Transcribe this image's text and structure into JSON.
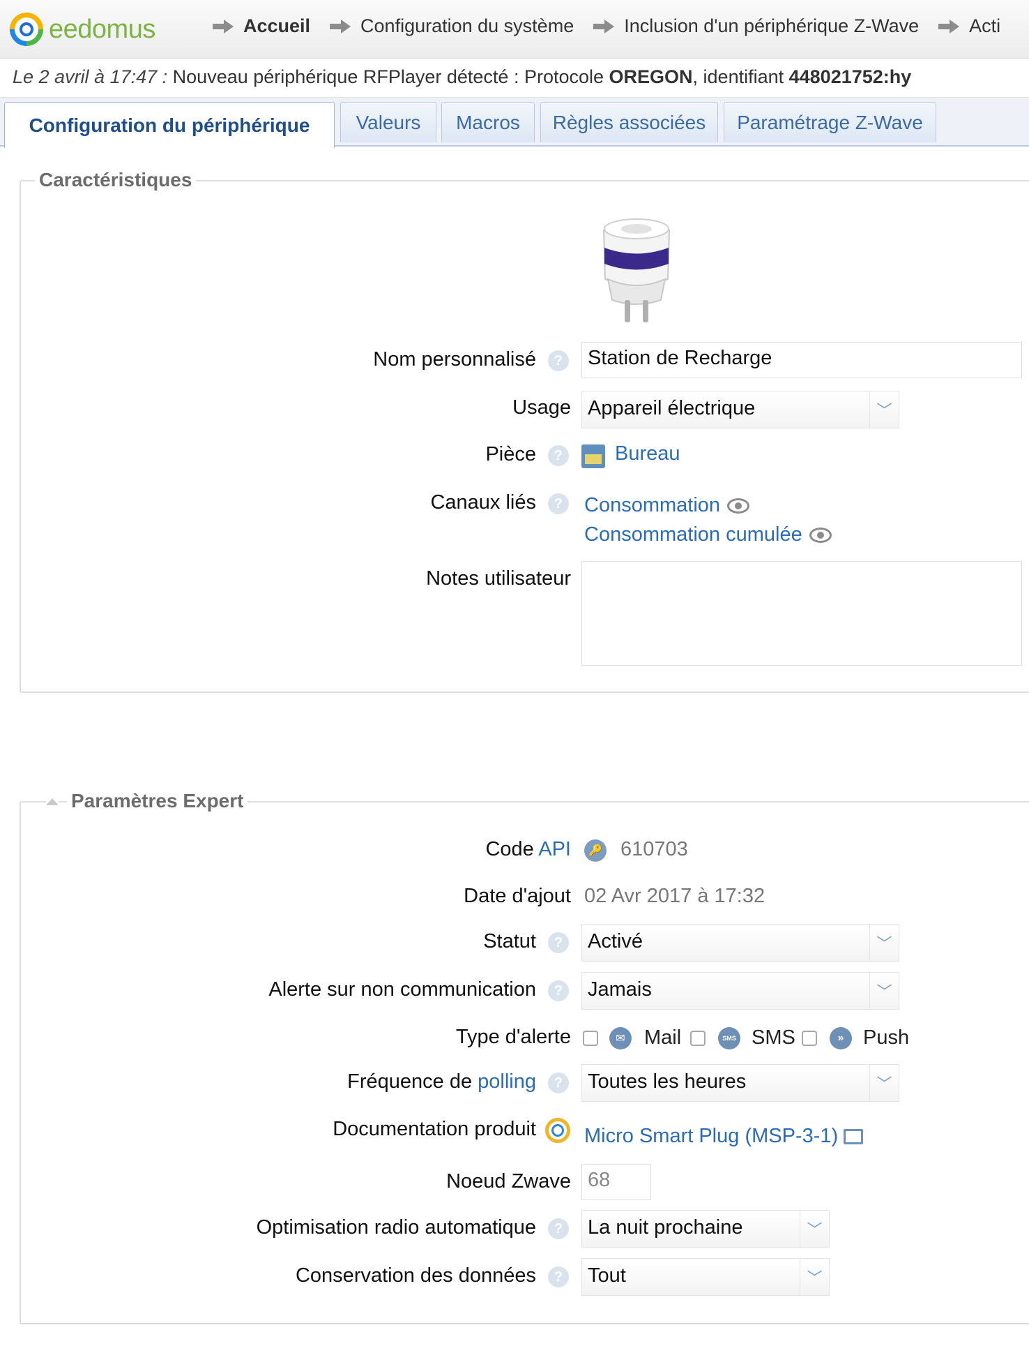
{
  "header": {
    "logo_text": "eedomus",
    "breadcrumbs": [
      {
        "label": "Accueil"
      },
      {
        "label": "Configuration du système"
      },
      {
        "label": "Inclusion d'un périphérique Z-Wave"
      },
      {
        "label": "Acti"
      }
    ]
  },
  "notice": {
    "date": "Le 2 avril à 17:47 :",
    "text_before": " Nouveau périphérique RFPlayer détecté : Protocole ",
    "protocol": "OREGON",
    "text_middle": ", identifiant ",
    "identifier": "448021752:hy"
  },
  "tabs": [
    {
      "label": "Configuration du périphérique",
      "active": true
    },
    {
      "label": "Valeurs"
    },
    {
      "label": "Macros"
    },
    {
      "label": "Règles associées"
    },
    {
      "label": "Paramétrage Z-Wave"
    }
  ],
  "characteristics": {
    "legend": "Caractéristiques",
    "custom_name_label": "Nom personnalisé",
    "custom_name_value": "Station de Recharge",
    "usage_label": "Usage",
    "usage_value": "Appareil électrique",
    "room_label": "Pièce",
    "room_value": "Bureau",
    "channels_label": "Canaux liés",
    "channels": [
      "Consommation",
      "Consommation cumulée"
    ],
    "notes_label": "Notes utilisateur",
    "notes_value": ""
  },
  "expert": {
    "legend": "Paramètres Expert",
    "api_label": "Code",
    "api_link": "API",
    "api_value": "610703",
    "date_label": "Date d'ajout",
    "date_value": "02 Avr 2017 à 17:32",
    "status_label": "Statut",
    "status_value": "Activé",
    "alert_label": "Alerte sur non communication",
    "alert_value": "Jamais",
    "alert_type_label": "Type d'alerte",
    "alert_types": [
      "Mail",
      "SMS",
      "Push"
    ],
    "sms_badge": "SMS",
    "polling_label": "Fréquence de",
    "polling_link": "polling",
    "polling_value": "Toutes les heures",
    "doc_label": "Documentation produit",
    "doc_link": "Micro Smart Plug (MSP-3-1)",
    "node_label": "Noeud Zwave",
    "node_value": "68",
    "radio_label": "Optimisation radio automatique",
    "radio_value": "La nuit prochaine",
    "retention_label": "Conservation des données",
    "retention_value": "Tout"
  },
  "icons": {
    "help": "?",
    "chevron": "﹀"
  },
  "colors": {
    "link": "#2a6cb8",
    "tab_text": "#3b6aa5",
    "logo_green": "#7cb342"
  }
}
